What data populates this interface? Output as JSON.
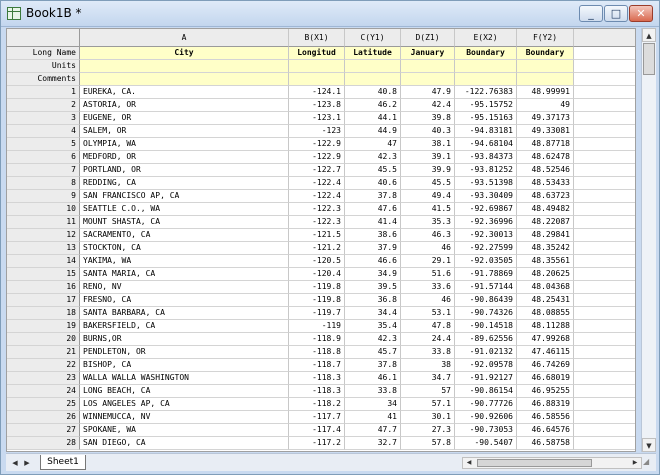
{
  "window": {
    "title": "Book1B *",
    "buttons": {
      "minimize": "_",
      "maximize": "□",
      "close": "✕"
    }
  },
  "columns": [
    {
      "letter": "A",
      "role": ""
    },
    {
      "letter": "B",
      "role": "(X1)"
    },
    {
      "letter": "C",
      "role": "(Y1)"
    },
    {
      "letter": "D",
      "role": "(Z1)"
    },
    {
      "letter": "E",
      "role": "(X2)"
    },
    {
      "letter": "F",
      "role": "(Y2)"
    }
  ],
  "meta_rows": [
    {
      "label": "Long Name",
      "values": [
        "City",
        "Longitud",
        "Latitude",
        "January",
        "Boundary",
        "Boundary"
      ]
    },
    {
      "label": "Units",
      "values": [
        "",
        "",
        "",
        "",
        "",
        ""
      ]
    },
    {
      "label": "Comments",
      "values": [
        "",
        "",
        "",
        "",
        "",
        ""
      ]
    }
  ],
  "rows": [
    {
      "n": "1",
      "city": "EUREKA, CA.",
      "b": "-124.1",
      "c": "40.8",
      "d": "47.9",
      "e": "-122.76383",
      "f": "48.99991"
    },
    {
      "n": "2",
      "city": "ASTORIA, OR",
      "b": "-123.8",
      "c": "46.2",
      "d": "42.4",
      "e": "-95.15752",
      "f": "49"
    },
    {
      "n": "3",
      "city": "EUGENE, OR",
      "b": "-123.1",
      "c": "44.1",
      "d": "39.8",
      "e": "-95.15163",
      "f": "49.37173"
    },
    {
      "n": "4",
      "city": "SALEM, OR",
      "b": "-123",
      "c": "44.9",
      "d": "40.3",
      "e": "-94.83181",
      "f": "49.33081"
    },
    {
      "n": "5",
      "city": "OLYMPIA, WA",
      "b": "-122.9",
      "c": "47",
      "d": "38.1",
      "e": "-94.68104",
      "f": "48.87718"
    },
    {
      "n": "6",
      "city": "MEDFORD, OR",
      "b": "-122.9",
      "c": "42.3",
      "d": "39.1",
      "e": "-93.84373",
      "f": "48.62478"
    },
    {
      "n": "7",
      "city": "PORTLAND, OR",
      "b": "-122.7",
      "c": "45.5",
      "d": "39.9",
      "e": "-93.81252",
      "f": "48.52546"
    },
    {
      "n": "8",
      "city": "REDDING, CA",
      "b": "-122.4",
      "c": "40.6",
      "d": "45.5",
      "e": "-93.51398",
      "f": "48.53433"
    },
    {
      "n": "9",
      "city": "SAN FRANCISCO AP, CA",
      "b": "-122.4",
      "c": "37.8",
      "d": "49.4",
      "e": "-93.30409",
      "f": "48.63723"
    },
    {
      "n": "10",
      "city": "SEATTLE C.O., WA",
      "b": "-122.3",
      "c": "47.6",
      "d": "41.5",
      "e": "-92.69867",
      "f": "48.49482"
    },
    {
      "n": "11",
      "city": "MOUNT SHASTA, CA",
      "b": "-122.3",
      "c": "41.4",
      "d": "35.3",
      "e": "-92.36996",
      "f": "48.22087"
    },
    {
      "n": "12",
      "city": "SACRAMENTO, CA",
      "b": "-121.5",
      "c": "38.6",
      "d": "46.3",
      "e": "-92.30013",
      "f": "48.29841"
    },
    {
      "n": "13",
      "city": "STOCKTON, CA",
      "b": "-121.2",
      "c": "37.9",
      "d": "46",
      "e": "-92.27599",
      "f": "48.35242"
    },
    {
      "n": "14",
      "city": "YAKIMA, WA",
      "b": "-120.5",
      "c": "46.6",
      "d": "29.1",
      "e": "-92.03505",
      "f": "48.35561"
    },
    {
      "n": "15",
      "city": "SANTA MARIA, CA",
      "b": "-120.4",
      "c": "34.9",
      "d": "51.6",
      "e": "-91.78869",
      "f": "48.20625"
    },
    {
      "n": "16",
      "city": "RENO, NV",
      "b": "-119.8",
      "c": "39.5",
      "d": "33.6",
      "e": "-91.57144",
      "f": "48.04368"
    },
    {
      "n": "17",
      "city": "FRESNO, CA",
      "b": "-119.8",
      "c": "36.8",
      "d": "46",
      "e": "-90.86439",
      "f": "48.25431"
    },
    {
      "n": "18",
      "city": "SANTA BARBARA, CA",
      "b": "-119.7",
      "c": "34.4",
      "d": "53.1",
      "e": "-90.74326",
      "f": "48.08855"
    },
    {
      "n": "19",
      "city": "BAKERSFIELD, CA",
      "b": "-119",
      "c": "35.4",
      "d": "47.8",
      "e": "-90.14518",
      "f": "48.11288"
    },
    {
      "n": "20",
      "city": "BURNS,OR",
      "b": "-118.9",
      "c": "42.3",
      "d": "24.4",
      "e": "-89.62556",
      "f": "47.99268"
    },
    {
      "n": "21",
      "city": "PENDLETON, OR",
      "b": "-118.8",
      "c": "45.7",
      "d": "33.8",
      "e": "-91.02132",
      "f": "47.46115"
    },
    {
      "n": "22",
      "city": "BISHOP, CA",
      "b": "-118.7",
      "c": "37.8",
      "d": "38",
      "e": "-92.09578",
      "f": "46.74269"
    },
    {
      "n": "23",
      "city": "WALLA WALLA WASHINGTON",
      "b": "-118.3",
      "c": "46.1",
      "d": "34.7",
      "e": "-91.92127",
      "f": "46.68019"
    },
    {
      "n": "24",
      "city": "LONG BEACH, CA",
      "b": "-118.3",
      "c": "33.8",
      "d": "57",
      "e": "-90.86154",
      "f": "46.95255"
    },
    {
      "n": "25",
      "city": "LOS ANGELES AP, CA",
      "b": "-118.2",
      "c": "34",
      "d": "57.1",
      "e": "-90.77726",
      "f": "46.88319"
    },
    {
      "n": "26",
      "city": "WINNEMUCCA, NV",
      "b": "-117.7",
      "c": "41",
      "d": "30.1",
      "e": "-90.92606",
      "f": "46.58556"
    },
    {
      "n": "27",
      "city": "SPOKANE, WA",
      "b": "-117.4",
      "c": "47.7",
      "d": "27.3",
      "e": "-90.73053",
      "f": "46.64576"
    },
    {
      "n": "28",
      "city": "SAN DIEGO, CA",
      "b": "-117.2",
      "c": "32.7",
      "d": "57.8",
      "e": "-90.5407",
      "f": "46.58758"
    }
  ],
  "tabs": [
    {
      "label": "Sheet1"
    }
  ]
}
